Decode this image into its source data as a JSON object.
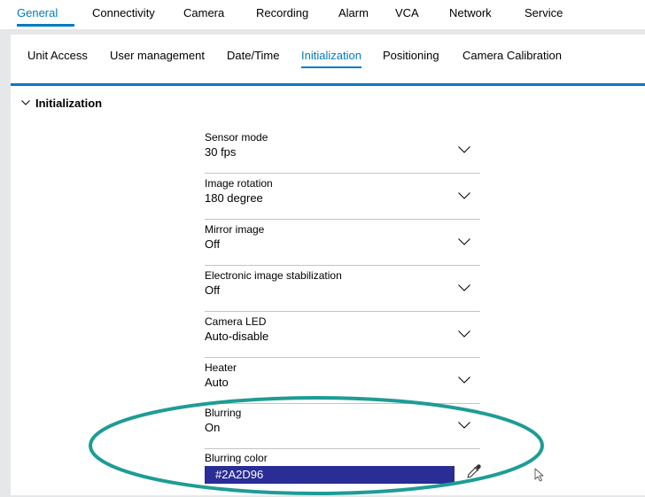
{
  "topnav": {
    "tabs": [
      {
        "label": "General",
        "active": true
      },
      {
        "label": "Connectivity"
      },
      {
        "label": "Camera"
      },
      {
        "label": "Recording"
      },
      {
        "label": "Alarm"
      },
      {
        "label": "VCA"
      },
      {
        "label": "Network"
      },
      {
        "label": "Service"
      }
    ]
  },
  "subnav": {
    "tabs": [
      {
        "label": "Unit Access"
      },
      {
        "label": "User management"
      },
      {
        "label": "Date/Time"
      },
      {
        "label": "Initialization",
        "active": true
      },
      {
        "label": "Positioning"
      },
      {
        "label": "Camera Calibration"
      }
    ]
  },
  "section": {
    "title": "Initialization",
    "icon": "chevron-down-icon"
  },
  "fields": [
    {
      "label": "Sensor mode",
      "value": "30 fps"
    },
    {
      "label": "Image rotation",
      "value": "180 degree"
    },
    {
      "label": "Mirror image",
      "value": "Off"
    },
    {
      "label": "Electronic image stabilization",
      "value": "Off"
    },
    {
      "label": "Camera LED",
      "value": "Auto-disable"
    },
    {
      "label": "Heater",
      "value": "Auto"
    },
    {
      "label": "Blurring",
      "value": "On"
    }
  ],
  "blurring_color": {
    "label": "Blurring color",
    "value": "#2A2D96",
    "icon": "eyedropper-icon"
  },
  "colors": {
    "accent": "#007bc0",
    "swatch": "#2A2D96",
    "highlight": "#1e9c96",
    "background": "#e6e7e8"
  }
}
